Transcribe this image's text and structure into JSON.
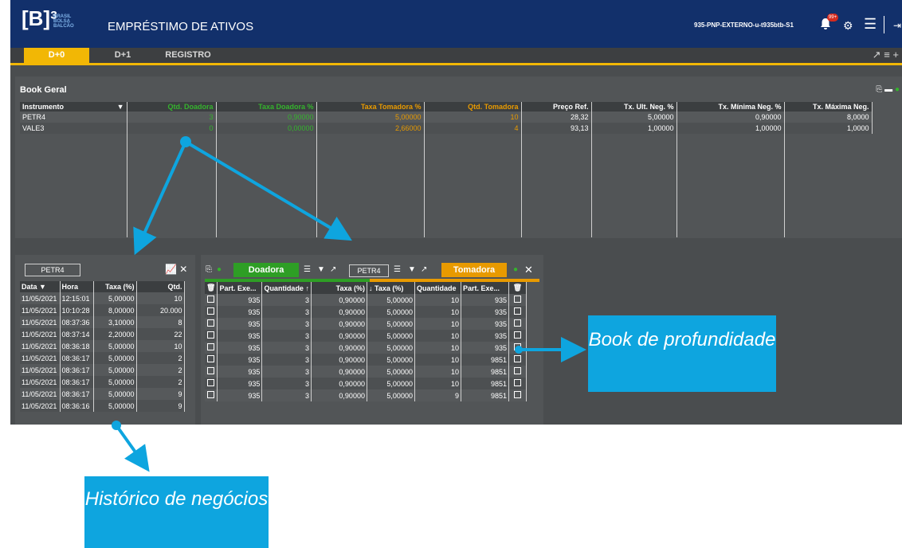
{
  "header": {
    "logo_text": "[B]³",
    "logo_sub": "BRASIL BOLSA BALCÃO",
    "title": "EMPRÉSTIMO DE ATIVOS",
    "user": "935-PNP-EXTERNO-u-t935btb-S1",
    "notifications_badge": "99+"
  },
  "tabs": [
    "D+0",
    "D+1",
    "REGISTRO"
  ],
  "book_geral": {
    "title": "Book Geral",
    "columns": [
      "Instrumento",
      "Qtd. Doadora",
      "Taxa Doadora %",
      "Taxa Tomadora %",
      "Qtd. Tomadora",
      "Preço Ref.",
      "Tx. Ult. Neg. %",
      "Tx. Mínima Neg. %",
      "Tx. Máxima Neg."
    ],
    "rows": [
      [
        "PETR4",
        "3",
        "0,90000",
        "5,00000",
        "10",
        "28,32",
        "5,00000",
        "0,90000",
        "8,0000"
      ],
      [
        "VALE3",
        "0",
        "0,00000",
        "2,66000",
        "4",
        "93,13",
        "1,00000",
        "1,00000",
        "1,0000"
      ]
    ]
  },
  "historico": {
    "symbol": "PETR4",
    "columns": [
      "Data",
      "Hora",
      "Taxa (%)",
      "Qtd."
    ],
    "rows": [
      [
        "11/05/2021",
        "12:15:01",
        "5,00000",
        "10"
      ],
      [
        "11/05/2021",
        "10:10:28",
        "8,00000",
        "20.000"
      ],
      [
        "11/05/2021",
        "08:37:36",
        "3,10000",
        "8"
      ],
      [
        "11/05/2021",
        "08:37:14",
        "2,20000",
        "22"
      ],
      [
        "11/05/2021",
        "08:36:18",
        "5,00000",
        "10"
      ],
      [
        "11/05/2021",
        "08:36:17",
        "5,00000",
        "2"
      ],
      [
        "11/05/2021",
        "08:36:17",
        "5,00000",
        "2"
      ],
      [
        "11/05/2021",
        "08:36:17",
        "5,00000",
        "2"
      ],
      [
        "11/05/2021",
        "08:36:17",
        "5,00000",
        "9"
      ],
      [
        "11/05/2021",
        "08:36:16",
        "5,00000",
        "9"
      ]
    ]
  },
  "profundidade": {
    "doadora_label": "Doadora",
    "tomadora_label": "Tomadora",
    "symbol": "PETR4",
    "columns": [
      "Part. Exe...",
      "Quantidade",
      "↑",
      "Taxa (%)",
      "↓",
      "Taxa (%)",
      "Quantidade",
      "Part. Exe..."
    ],
    "rows": [
      [
        "935",
        "3",
        "0,90000",
        "5,00000",
        "10",
        "935"
      ],
      [
        "935",
        "3",
        "0,90000",
        "5,00000",
        "10",
        "935"
      ],
      [
        "935",
        "3",
        "0,90000",
        "5,00000",
        "10",
        "935"
      ],
      [
        "935",
        "3",
        "0,90000",
        "5,00000",
        "10",
        "935"
      ],
      [
        "935",
        "3",
        "0,90000",
        "5,00000",
        "10",
        "935"
      ],
      [
        "935",
        "3",
        "0,90000",
        "5,00000",
        "10",
        "9851"
      ],
      [
        "935",
        "3",
        "0,90000",
        "5,00000",
        "10",
        "9851"
      ],
      [
        "935",
        "3",
        "0,90000",
        "5,00000",
        "10",
        "9851"
      ],
      [
        "935",
        "3",
        "0,90000",
        "5,00000",
        "9",
        "9851"
      ]
    ]
  },
  "callouts": {
    "book": "Book de profundidade",
    "historico": "Histórico de negócios"
  },
  "colors": {
    "navy": "#12306b",
    "accent": "#f2b705",
    "green": "#35b32d",
    "orange": "#e89a00",
    "callout": "#0ea5df"
  }
}
